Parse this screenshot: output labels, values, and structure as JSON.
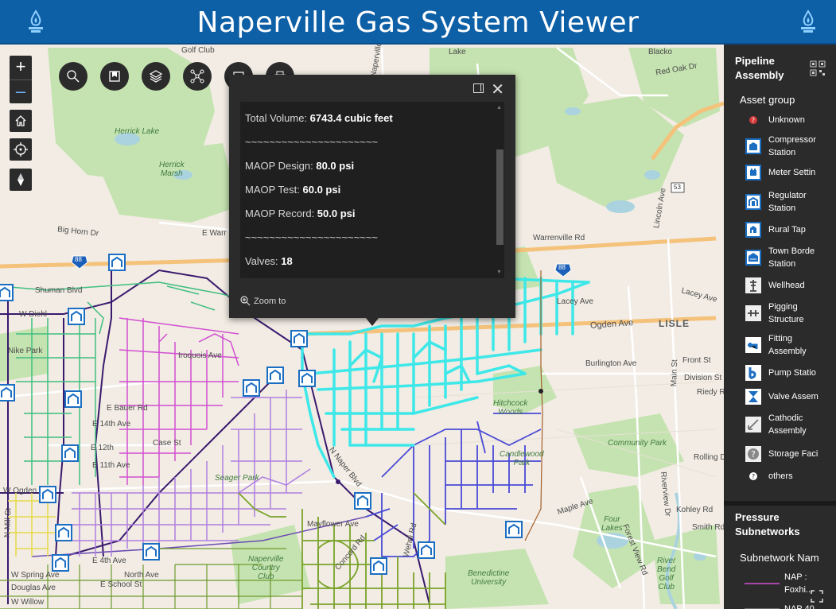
{
  "header": {
    "title": "Naperville Gas System Viewer",
    "brand_color": "#0d5fa6"
  },
  "map": {
    "labels": {
      "golf_club": "Golf Club",
      "lake": "Lake",
      "blackoak": "Blacko",
      "naperville_road": "Naperville Rd",
      "red_oak": "Red Oak Dr",
      "herrick_lake": "Herrick Lake",
      "herrick_marsh": "Herrick\nMarsh",
      "big_horn": "Big Horn Dr",
      "e_warr": "E Warr",
      "warrenville": "Warrenville Rd",
      "shuman": "Shuman Blvd",
      "w_diehl": "W Diehl",
      "lacey_ave": "Lacey Ave",
      "lacey_ave2": "Lacey Ave",
      "ogden": "Ogden Ave",
      "lisle": "LISLE",
      "nike_park": "Nike Park",
      "iroquois": "Iroquois Ave",
      "burlington": "Burlington Ave",
      "front_st": "Front St",
      "division": "Division St",
      "riedy": "Riedy Rd",
      "e_bauer": "E Bauer Rd",
      "e_14th": "E 14th Ave",
      "e_12th": "E 12th",
      "e_11th": "E 11th Ave",
      "case_st": "Case St",
      "hitchcock": "Hitchcock\nWoods",
      "community_park": "Community Park",
      "candlewood": "Candlewood\nPark",
      "rolling": "Rolling D",
      "lincoln": "Lincoln Ave",
      "main_st": "Main St",
      "seager": "Seager Park",
      "n_naper": "N Naper Blvd",
      "w_ogden": "W Ogden",
      "mayflower": "Mayflower Ave",
      "maple": "Maple Ave",
      "kohley": "Kohley Rd",
      "smith": "Smith Rd",
      "four_lakes": "Four\nLakes",
      "forest_view": "Forest View Rd",
      "riverview": "Riverview Dr",
      "river_bend": "River\nBend\nGolf\nClub",
      "naperville_cc": "Naperville\nCountry\nClub",
      "benedictine": "Benedictine\nUniversity",
      "e_4th": "E 4th Ave",
      "north_ave": "North Ave",
      "w_spring": "W Spring Ave",
      "douglas": "Douglas Ave",
      "e_school": "E School St",
      "w_willow": "W Willow",
      "n_mill": "N Mill St",
      "concord": "Concord Rd",
      "wehrli": "Wehrli Rd",
      "route_53": "53",
      "route_88a": "88",
      "route_88b": "88"
    }
  },
  "toolbar": {
    "zoom_in": "+",
    "zoom_out": "–"
  },
  "popup": {
    "lines": [
      {
        "label": "Total Volume: ",
        "value": "6743.4 cubic feet"
      },
      {
        "label": "~~~~~~~~~~~~~~~~~~~~~~",
        "value": ""
      },
      {
        "label": "MAOP Design: ",
        "value": "80.0 psi"
      },
      {
        "label": "MAOP Test: ",
        "value": "60.0 psi"
      },
      {
        "label": "MAOP Record: ",
        "value": "50.0 psi"
      },
      {
        "label": "~~~~~~~~~~~~~~~~~~~~~~",
        "value": ""
      },
      {
        "label": "Valves: ",
        "value": "18"
      }
    ],
    "zoom_to": "Zoom to",
    "close": "✕"
  },
  "legend": {
    "title1": "Pipeline\nAssembly",
    "group1": "Asset group",
    "items": [
      {
        "label": "Unknown",
        "icon": "unknown-icon"
      },
      {
        "label": "Compressor\nStation",
        "icon": "compressor-icon"
      },
      {
        "label": "Meter Settin",
        "icon": "meter-icon"
      },
      {
        "label": "Regulator\nStation",
        "icon": "regulator-icon"
      },
      {
        "label": "Rural Tap",
        "icon": "rural-tap-icon"
      },
      {
        "label": "Town Borde\nStation",
        "icon": "town-border-icon"
      },
      {
        "label": "Wellhead",
        "icon": "wellhead-icon"
      },
      {
        "label": "Pigging\nStructure",
        "icon": "pigging-icon"
      },
      {
        "label": "Fitting\nAssembly",
        "icon": "fitting-icon"
      },
      {
        "label": "Pump Statio",
        "icon": "pump-icon"
      },
      {
        "label": "Valve Assem",
        "icon": "valve-icon"
      },
      {
        "label": "Cathodic\nAssembly",
        "icon": "cathodic-icon"
      },
      {
        "label": "Storage Faci",
        "icon": "storage-icon"
      },
      {
        "label": "others",
        "icon": "others-icon"
      }
    ],
    "title2": "Pressure\nSubnetworks",
    "group2": "Subnetwork Nam",
    "sub_items": [
      {
        "label": "NAP :\nFoxhi..."
      },
      {
        "label": "NAP 40"
      }
    ]
  },
  "colors": {
    "cyan": "#3ee8e8",
    "purple": "#b07fe0",
    "magenta": "#d24fd2",
    "blue": "#4a4ad6",
    "olive": "#7aa32a",
    "green": "#3fbf7f",
    "yellow": "#e6d94a",
    "navy": "#3a1a6e"
  }
}
